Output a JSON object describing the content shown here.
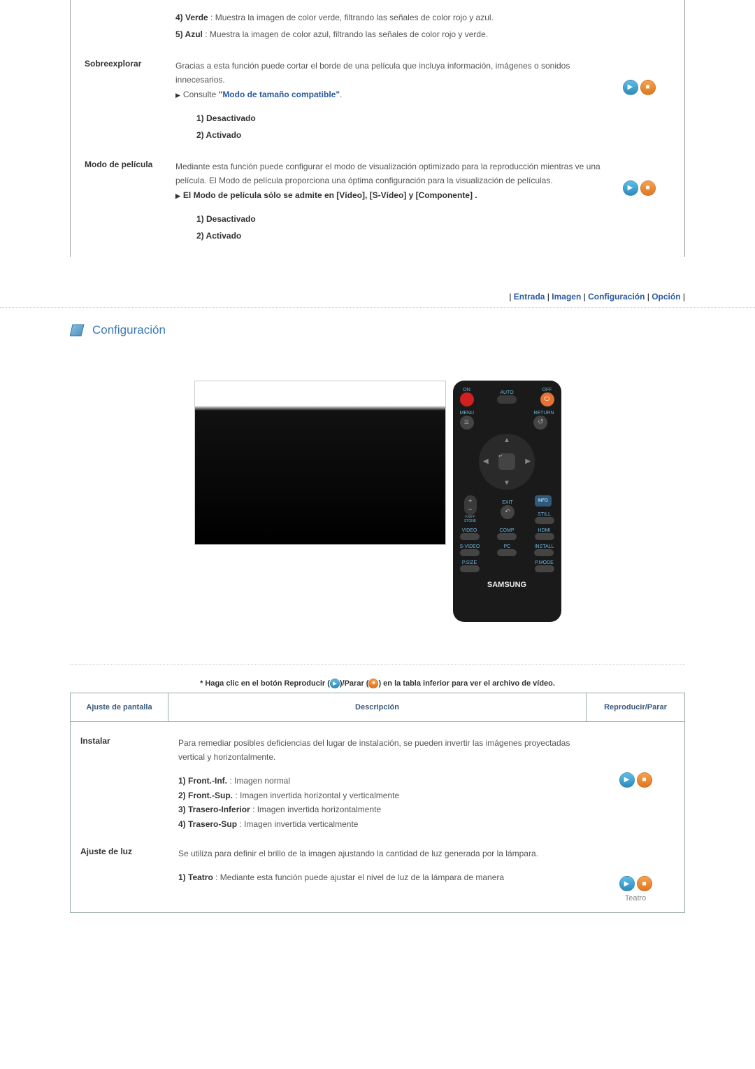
{
  "prev_table": {
    "rows_before": [
      {
        "bold": "4) Verde",
        "text": " : Muestra la imagen de color verde, filtrando las señales de color rojo y azul."
      },
      {
        "bold": "5) Azul",
        "text": " : Muestra la imagen de color azul, filtrando las señales de color rojo y verde."
      }
    ],
    "sobreexplorar": {
      "label": "Sobreexplorar",
      "desc1": "Gracias a esta función puede cortar el borde de una película que incluya información, imágenes o sonidos innecesarios.",
      "consult_prefix": "Consulte ",
      "consult_link": "\"Modo de tamaño compatible\"",
      "consult_suffix": ".",
      "opt1": "1) Desactivado",
      "opt2": "2) Activado"
    },
    "modo_pelicula": {
      "label": "Modo de película",
      "desc1": "Mediante esta función puede configurar el modo de visualización optimizado para la reproducción mientras ve una película. El Modo de película proporciona una óptima configuración para la visualización de películas.",
      "note": "El Modo de película sólo se admite en [Vídeo], [S-Vídeo] y [Componente] .",
      "opt1": "1) Desactivado",
      "opt2": "2) Activado"
    }
  },
  "nav": {
    "entrada": "Entrada",
    "imagen": "Imagen",
    "configuracion": "Configuración",
    "opcion": "Opción"
  },
  "section_title": "Configuración",
  "remote": {
    "on": "ON",
    "off": "OFF",
    "auto": "AUTO",
    "menu": "MENU",
    "return": "RETURN",
    "vkeystone": "V.KEY-STONE",
    "exit": "EXIT",
    "info": "INFO",
    "still": "STILL",
    "video": "VIDEO",
    "comp": "COMP",
    "hdmi": "HDMI",
    "svideo": "S-VIDEO",
    "pc": "PC",
    "install": "INSTALL",
    "psize": "P.SIZE",
    "pmode": "P.MODE",
    "brand": "SAMSUNG"
  },
  "video_hint": {
    "prefix": "* Haga clic en el botón Reproducir (",
    "mid": ")/Parar (",
    "suffix": ") en la tabla inferior para ver el archivo de vídeo."
  },
  "table2": {
    "headers": {
      "c1": "Ajuste de pantalla",
      "c2": "Descripción",
      "c3": "Reproducir/Parar"
    },
    "instalar": {
      "label": "Instalar",
      "desc": "Para remediar posibles deficiencias del lugar de instalación, se pueden invertir las imágenes proyectadas vertical y horizontalmente.",
      "opts": [
        {
          "b": "1) Front.-Inf.",
          "t": " : Imagen normal"
        },
        {
          "b": "2) Front.-Sup.",
          "t": " : Imagen invertida horizontal y verticalmente"
        },
        {
          "b": "3) Trasero-Inferior",
          "t": " : Imagen invertida horizontalmente"
        },
        {
          "b": "4) Trasero-Sup",
          "t": " : Imagen invertida verticalmente"
        }
      ]
    },
    "ajuste_luz": {
      "label": "Ajuste de luz",
      "desc": "Se utiliza para definir el brillo de la imagen ajustando la cantidad de luz generada por la lámpara.",
      "opt1_b": "1) Teatro",
      "opt1_t": " : Mediante esta función puede ajustar el nivel de luz de la lámpara de manera",
      "media_label": "Teatro"
    }
  }
}
